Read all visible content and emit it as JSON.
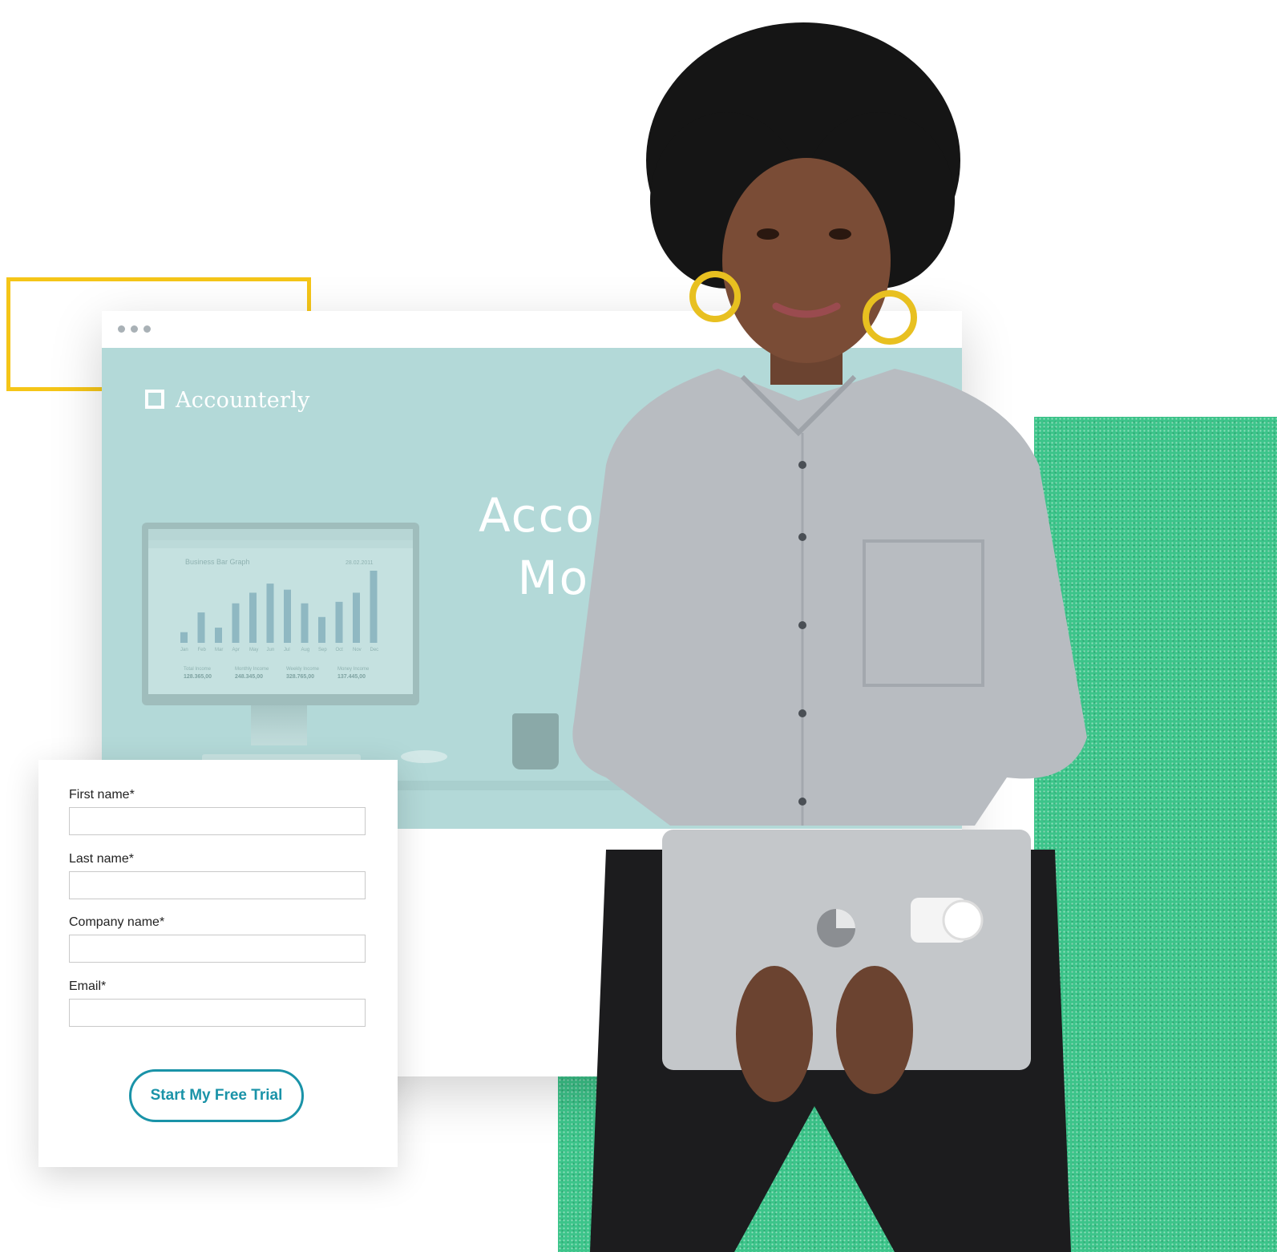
{
  "site": {
    "logo_text": "Accounterly",
    "headline": "Acco\n  Mo"
  },
  "monitor_screen": {
    "chart_title": "Business Bar Graph",
    "chart_date": "28.02.2011",
    "months": [
      "Jan",
      "Feb",
      "Mar",
      "Apr",
      "May",
      "Jun",
      "Jul",
      "Aug",
      "Sep",
      "Oct",
      "Nov",
      "Dec"
    ],
    "bar_values": [
      14,
      40,
      20,
      52,
      66,
      78,
      70,
      52,
      34,
      54,
      66,
      95
    ],
    "totals": [
      {
        "label": "Total Income",
        "value": "128.365,00"
      },
      {
        "label": "Monthly Income",
        "value": "248.345,00"
      },
      {
        "label": "Weekly Income",
        "value": "328.765,00"
      },
      {
        "label": "Money Income",
        "value": "137.445,00"
      }
    ]
  },
  "form": {
    "fields": [
      {
        "label": "First name*",
        "value": ""
      },
      {
        "label": "Last name*",
        "value": ""
      },
      {
        "label": "Company name*",
        "value": ""
      },
      {
        "label": "Email*",
        "value": ""
      }
    ],
    "submit_label": "Start My Free Trial"
  },
  "colors": {
    "accent": "#1a93a8",
    "frame_yellow": "#f5c518",
    "panel_green": "#3cc48a",
    "site_teal": "#b3d9d8"
  }
}
